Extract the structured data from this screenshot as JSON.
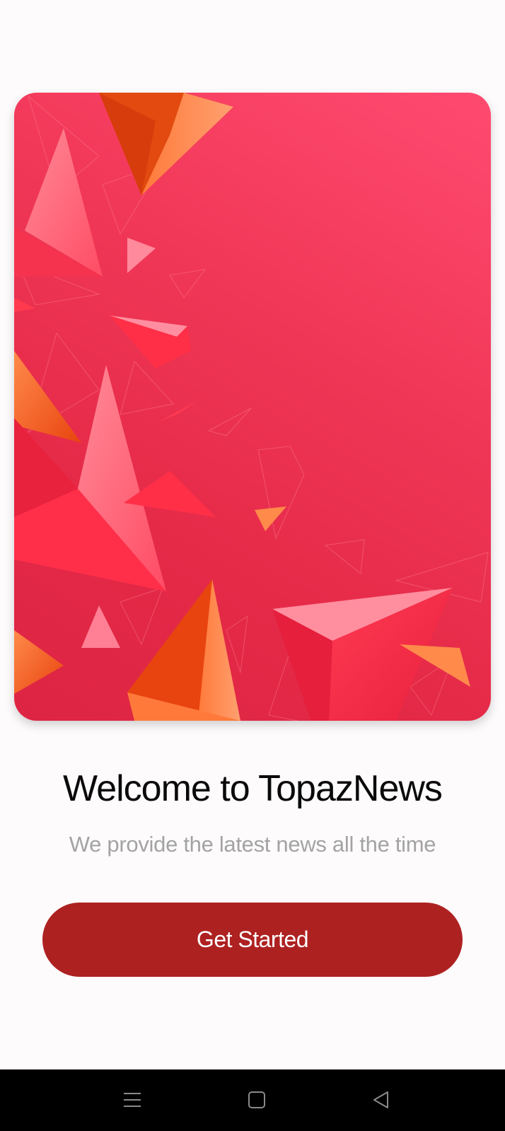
{
  "welcome": {
    "title": "Welcome to TopazNews",
    "subtitle": "We provide the latest news all the time"
  },
  "cta": {
    "label": "Get Started"
  },
  "colors": {
    "accent_button": "#ae2121",
    "hero_gradient_light": "#ff4a70",
    "hero_gradient_dark": "#dd2443",
    "title_text": "#0a0a0a",
    "subtitle_text": "#a3a3a3",
    "background": "#fdfbfc",
    "navbar": "#000000"
  },
  "hero": {
    "illustration": "abstract-red-orange-triangles"
  },
  "navbar": {
    "icons": [
      "recent-apps-icon",
      "home-icon",
      "back-icon"
    ]
  }
}
